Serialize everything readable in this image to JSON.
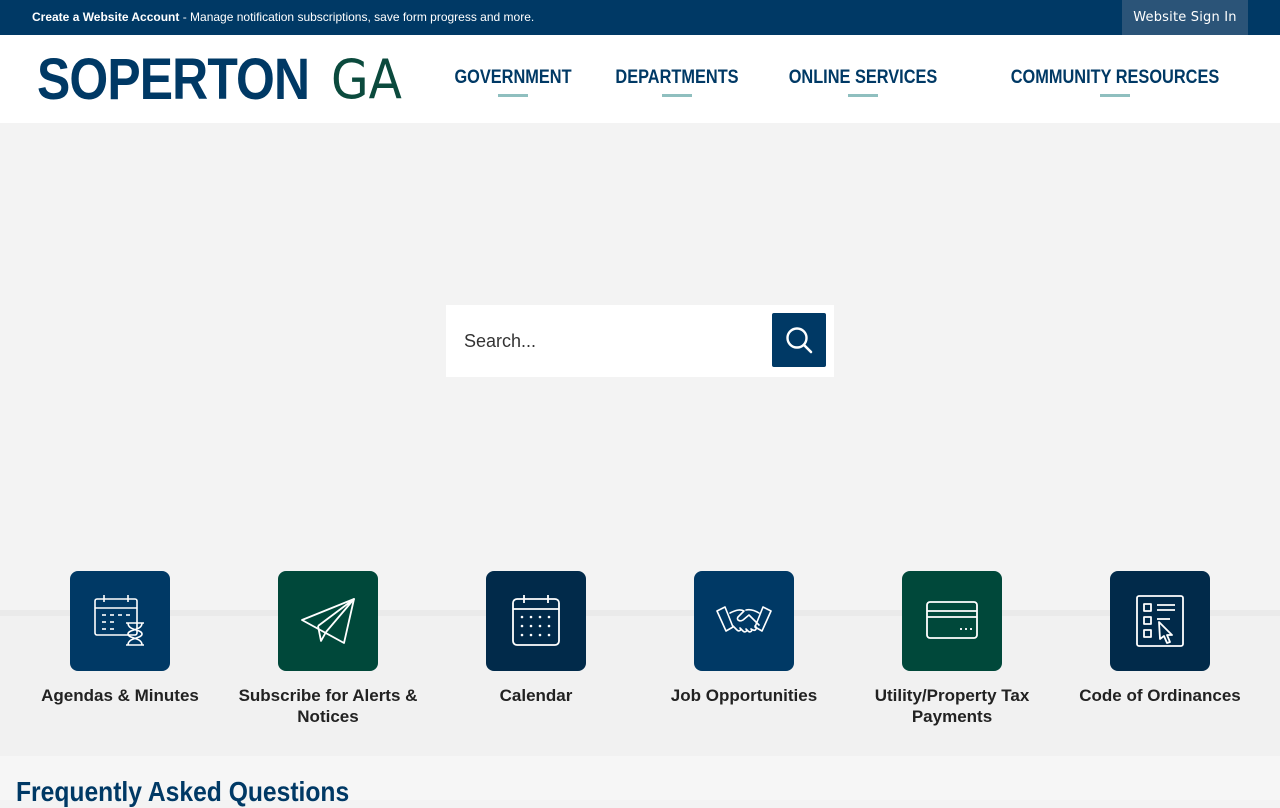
{
  "topbar": {
    "account_link_bold": "Create a Website Account",
    "account_link_rest": " - Manage notification subscriptions, save form progress and more.",
    "signin_label": "Website Sign In"
  },
  "logo": {
    "main": "SOPERTON",
    "suffix": "GA"
  },
  "nav": {
    "items": [
      {
        "label": "GOVERNMENT"
      },
      {
        "label": "DEPARTMENTS"
      },
      {
        "label": "ONLINE SERVICES"
      },
      {
        "label": "COMMUNITY RESOURCES"
      }
    ]
  },
  "search": {
    "placeholder": "Search..."
  },
  "quick_links": [
    {
      "label": "Agendas & Minutes",
      "icon": "calendar-hourglass-icon",
      "color": "#003965"
    },
    {
      "label": "Subscribe for Alerts & Notices",
      "icon": "paper-plane-icon",
      "color": "#00483a"
    },
    {
      "label": "Calendar",
      "icon": "calendar-icon",
      "color": "#012a4a"
    },
    {
      "label": "Job Opportunities",
      "icon": "handshake-icon",
      "color": "#003965"
    },
    {
      "label": "Utility/Property Tax Payments",
      "icon": "credit-card-icon",
      "color": "#00483a"
    },
    {
      "label": "Code of Ordinances",
      "icon": "checklist-icon",
      "color": "#012a4a"
    }
  ],
  "faq": {
    "heading": "Frequently Asked Questions"
  },
  "colors": {
    "primary": "#003965",
    "green": "#00483a",
    "dark": "#012a4a",
    "accent": "#8fbfbf"
  }
}
